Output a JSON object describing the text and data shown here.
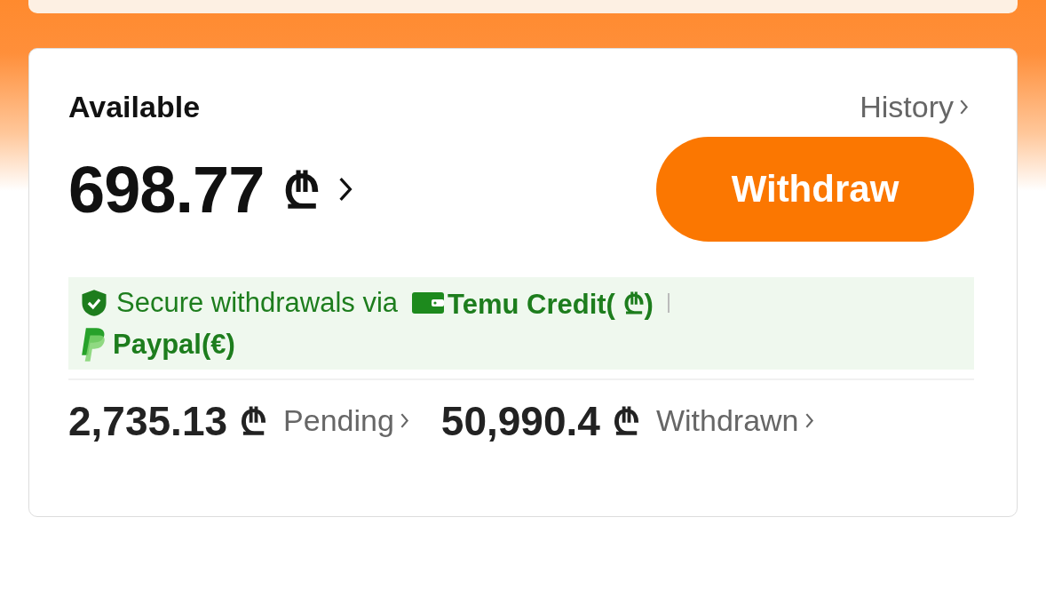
{
  "balance": {
    "label": "Available",
    "history_link": "History",
    "amount": "698.77",
    "currency": "₾",
    "withdraw_button": "Withdraw"
  },
  "secure_notice": {
    "text": "Secure withdrawals via",
    "methods": [
      {
        "kind": "wallet",
        "name": "Temu Credit",
        "currency": "( ₾)"
      },
      {
        "kind": "paypal",
        "name": "Paypal",
        "currency": "(€)"
      }
    ]
  },
  "totals": [
    {
      "amount": "2,735.13",
      "currency": "₾",
      "label": "Pending"
    },
    {
      "amount": "50,990.4",
      "currency": "₾",
      "label": "Withdrawn"
    }
  ]
}
